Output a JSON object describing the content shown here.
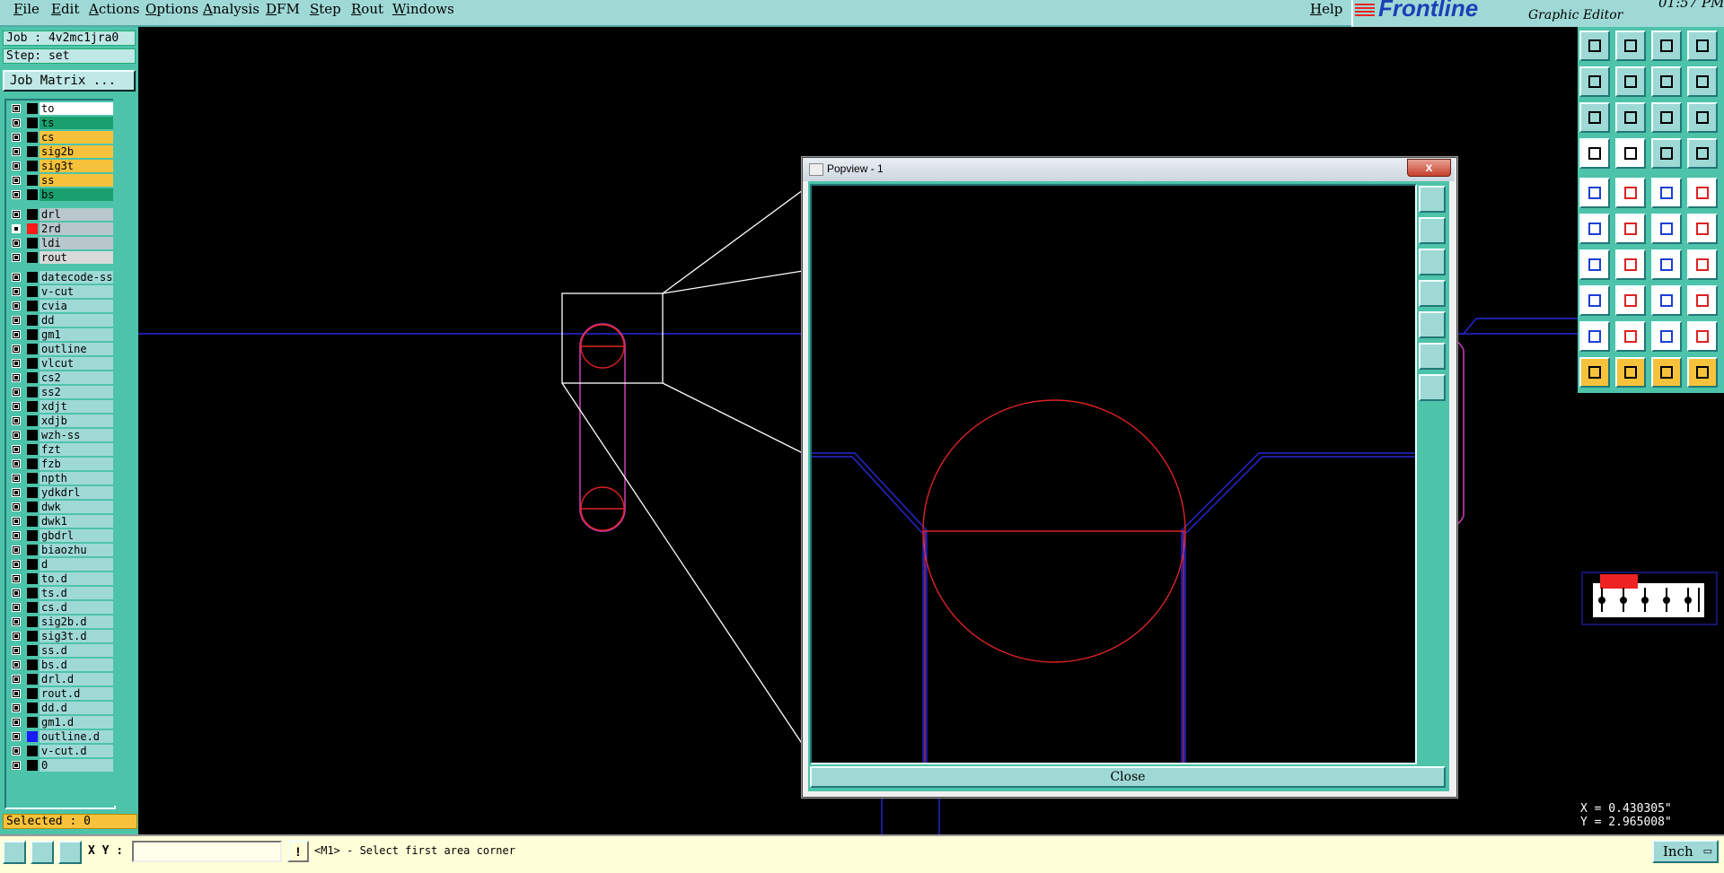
{
  "menu": {
    "items": [
      "File",
      "Edit",
      "Actions",
      "Options",
      "Analysis",
      "DFM",
      "Step",
      "Rout",
      "Windows"
    ],
    "help": "Help"
  },
  "brand": {
    "logo": "Frontline",
    "subtitle": "Graphic Editor",
    "time": "01:57 PM"
  },
  "job": {
    "job_label": "Job : 4v2mc1jra0",
    "step_label": "Step: set",
    "matrix_button": "Job Matrix ..."
  },
  "layers": [
    {
      "name": "to",
      "bg": "#ffffff"
    },
    {
      "name": "ts",
      "bg": "#1aa06e"
    },
    {
      "name": "cs",
      "bg": "#f7c23b"
    },
    {
      "name": "sig2b",
      "bg": "#f7c23b"
    },
    {
      "name": "sig3t",
      "bg": "#f7c23b"
    },
    {
      "name": "ss",
      "bg": "#f7c23b"
    },
    {
      "name": "bs",
      "bg": "#1aa06e"
    },
    {
      "name": "drl",
      "bg": "#b8c8cc"
    },
    {
      "name": "2rd",
      "bg": "#b8c8cc",
      "swatch": "#ff1a1a",
      "active": true
    },
    {
      "name": "ldi",
      "bg": "#b8c8cc"
    },
    {
      "name": "rout",
      "bg": "#d9d9d9"
    },
    {
      "name": "datecode-ss",
      "bg": "#9fd9d6"
    },
    {
      "name": "v-cut",
      "bg": "#9fd9d6"
    },
    {
      "name": "cvia",
      "bg": "#9fd9d6"
    },
    {
      "name": "dd",
      "bg": "#9fd9d6"
    },
    {
      "name": "gm1",
      "bg": "#9fd9d6"
    },
    {
      "name": "outline",
      "bg": "#9fd9d6"
    },
    {
      "name": "vlcut",
      "bg": "#9fd9d6"
    },
    {
      "name": "cs2",
      "bg": "#9fd9d6"
    },
    {
      "name": "ss2",
      "bg": "#9fd9d6"
    },
    {
      "name": "xdjt",
      "bg": "#9fd9d6"
    },
    {
      "name": "xdjb",
      "bg": "#9fd9d6"
    },
    {
      "name": "wzh-ss",
      "bg": "#9fd9d6"
    },
    {
      "name": "fzt",
      "bg": "#9fd9d6"
    },
    {
      "name": "fzb",
      "bg": "#9fd9d6"
    },
    {
      "name": "npth",
      "bg": "#9fd9d6"
    },
    {
      "name": "ydkdrl",
      "bg": "#9fd9d6"
    },
    {
      "name": "dwk",
      "bg": "#9fd9d6"
    },
    {
      "name": "dwk1",
      "bg": "#9fd9d6"
    },
    {
      "name": "gbdrl",
      "bg": "#9fd9d6"
    },
    {
      "name": "biaozhu",
      "bg": "#9fd9d6"
    },
    {
      "name": "d",
      "bg": "#9fd9d6"
    },
    {
      "name": "to.d",
      "bg": "#9fd9d6"
    },
    {
      "name": "ts.d",
      "bg": "#9fd9d6"
    },
    {
      "name": "cs.d",
      "bg": "#9fd9d6"
    },
    {
      "name": "sig2b.d",
      "bg": "#9fd9d6"
    },
    {
      "name": "sig3t.d",
      "bg": "#9fd9d6"
    },
    {
      "name": "ss.d",
      "bg": "#9fd9d6"
    },
    {
      "name": "bs.d",
      "bg": "#9fd9d6"
    },
    {
      "name": "drl.d",
      "bg": "#9fd9d6"
    },
    {
      "name": "rout.d",
      "bg": "#9fd9d6"
    },
    {
      "name": "dd.d",
      "bg": "#9fd9d6"
    },
    {
      "name": "gm1.d",
      "bg": "#9fd9d6"
    },
    {
      "name": "outline.d",
      "bg": "#9fd9d6",
      "swatch": "#1a1aff"
    },
    {
      "name": "v-cut.d",
      "bg": "#9fd9d6"
    },
    {
      "name": "0",
      "bg": "#9fd9d6"
    }
  ],
  "status": {
    "selected": "Selected : 0",
    "xy_label": "X Y :",
    "xy_value": "",
    "bang": "!",
    "prompt": "<M1> - Select first area corner",
    "units": "Inch",
    "coord_x": "X = 0.430305\"",
    "coord_y": "Y = 2.965008\""
  },
  "popview": {
    "title": "Popview - 1",
    "close_x": "x",
    "close_button": "Close"
  },
  "colors": {
    "panel": "#4dc3aa",
    "menu": "#9fd9d6",
    "trace": "#2828d8",
    "pad": "#d22",
    "rout": "#c23ab0"
  }
}
